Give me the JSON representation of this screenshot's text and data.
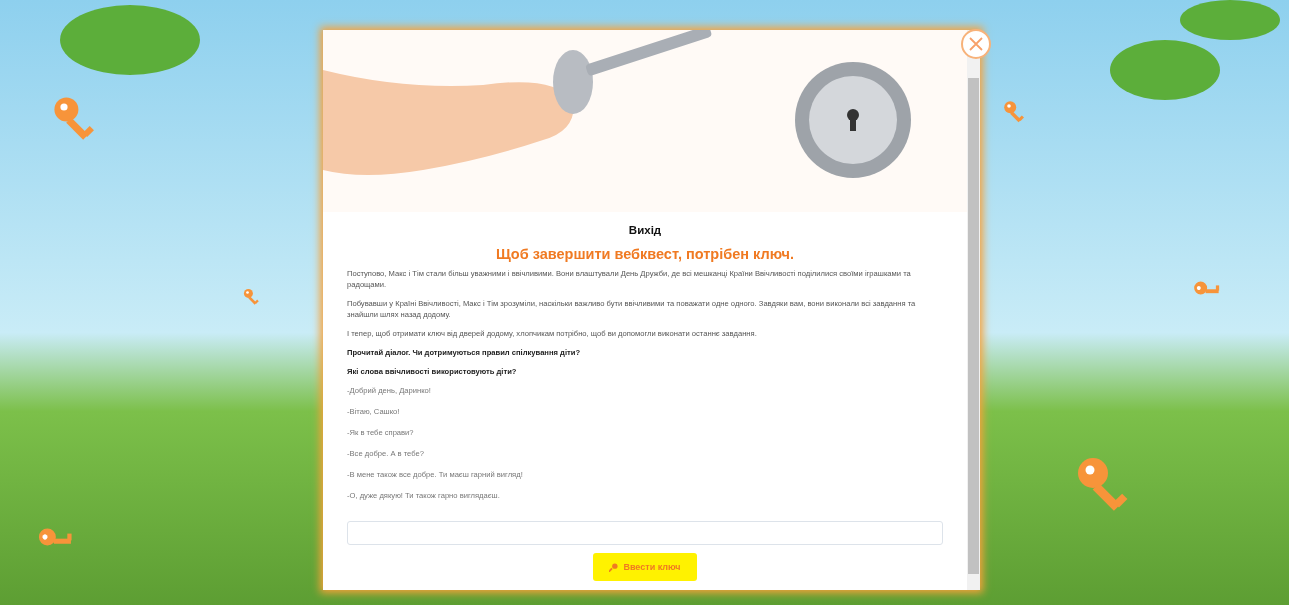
{
  "dialog": {
    "title": "Вихід",
    "subtitle": "Щоб завершити вебквест, потрібен ключ.",
    "paragraphs": [
      {
        "kind": "plain",
        "text": "Поступово, Макс і Тім стали більш уважними і ввічливими. Вони влаштували День Дружби, де всі мешканці Країни Ввічливості поділилися своїми іграшками та радощами."
      },
      {
        "kind": "plain",
        "text": "Побувавши у Країні Ввічливості, Макс і Тім зрозуміли, наскільки важливо бути ввічливими та поважати одне одного. Завдяки вам, вони виконали всі завдання та знайшли шлях назад додому."
      },
      {
        "kind": "plain",
        "text": "І тепер, щоб отримати ключ від дверей додому, хлопчикам потрібно, щоб ви допомогли виконати останнє завдання."
      },
      {
        "kind": "question",
        "text": "Прочитай діалог. Чи дотримуються правил спілкування діти?"
      },
      {
        "kind": "question",
        "text": "Які слова ввічливості використовують діти?"
      },
      {
        "kind": "dialogue",
        "text": "-Добрий день, Даринко!"
      },
      {
        "kind": "dialogue",
        "text": "-Вітаю, Сашко!"
      },
      {
        "kind": "dialogue",
        "text": "-Як в тебе справи?"
      },
      {
        "kind": "dialogue",
        "text": "-Все добре. А в тебе?"
      },
      {
        "kind": "dialogue",
        "text": "-В мене також все добре. Ти маєш гарний вигляд!"
      },
      {
        "kind": "dialogue",
        "text": "-О, дуже дякую! Ти також гарно виглядаєш."
      }
    ],
    "submit_button": "Ввести ключ"
  }
}
